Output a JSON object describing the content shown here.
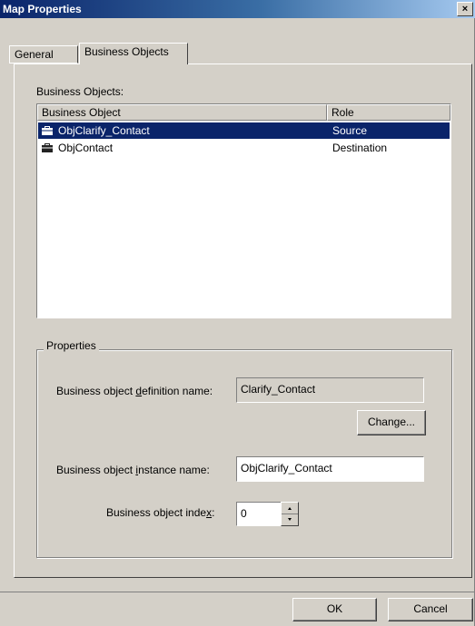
{
  "window": {
    "title": "Map Properties",
    "close_glyph": "×"
  },
  "tabs": [
    {
      "label": "General",
      "active": false
    },
    {
      "label": "Business Objects",
      "active": true
    }
  ],
  "business_objects": {
    "label": "Business Objects:",
    "columns": [
      "Business Object",
      "Role"
    ],
    "rows": [
      {
        "name": "ObjClarify_Contact",
        "role": "Source",
        "icon": "business-object-icon",
        "selected": true
      },
      {
        "name": "ObjContact",
        "role": "Destination",
        "icon": "business-object-icon",
        "selected": false
      }
    ]
  },
  "properties": {
    "legend": "Properties",
    "definition": {
      "label_pre": "Business object ",
      "label_key": "d",
      "label_post": "efinition name:",
      "value": "Clarify_Contact"
    },
    "change_button": "Change...",
    "instance": {
      "label_pre": "Business object ",
      "label_key": "i",
      "label_post": "nstance name:",
      "value": "ObjClarify_Contact"
    },
    "index": {
      "label_pre": "Business object inde",
      "label_key": "x",
      "label_post": ":",
      "value": "0"
    }
  },
  "footer": {
    "ok": "OK",
    "cancel": "Cancel"
  },
  "colors": {
    "selection": "#0a246a",
    "face": "#d4d0c8",
    "title_start": "#0a246a"
  }
}
